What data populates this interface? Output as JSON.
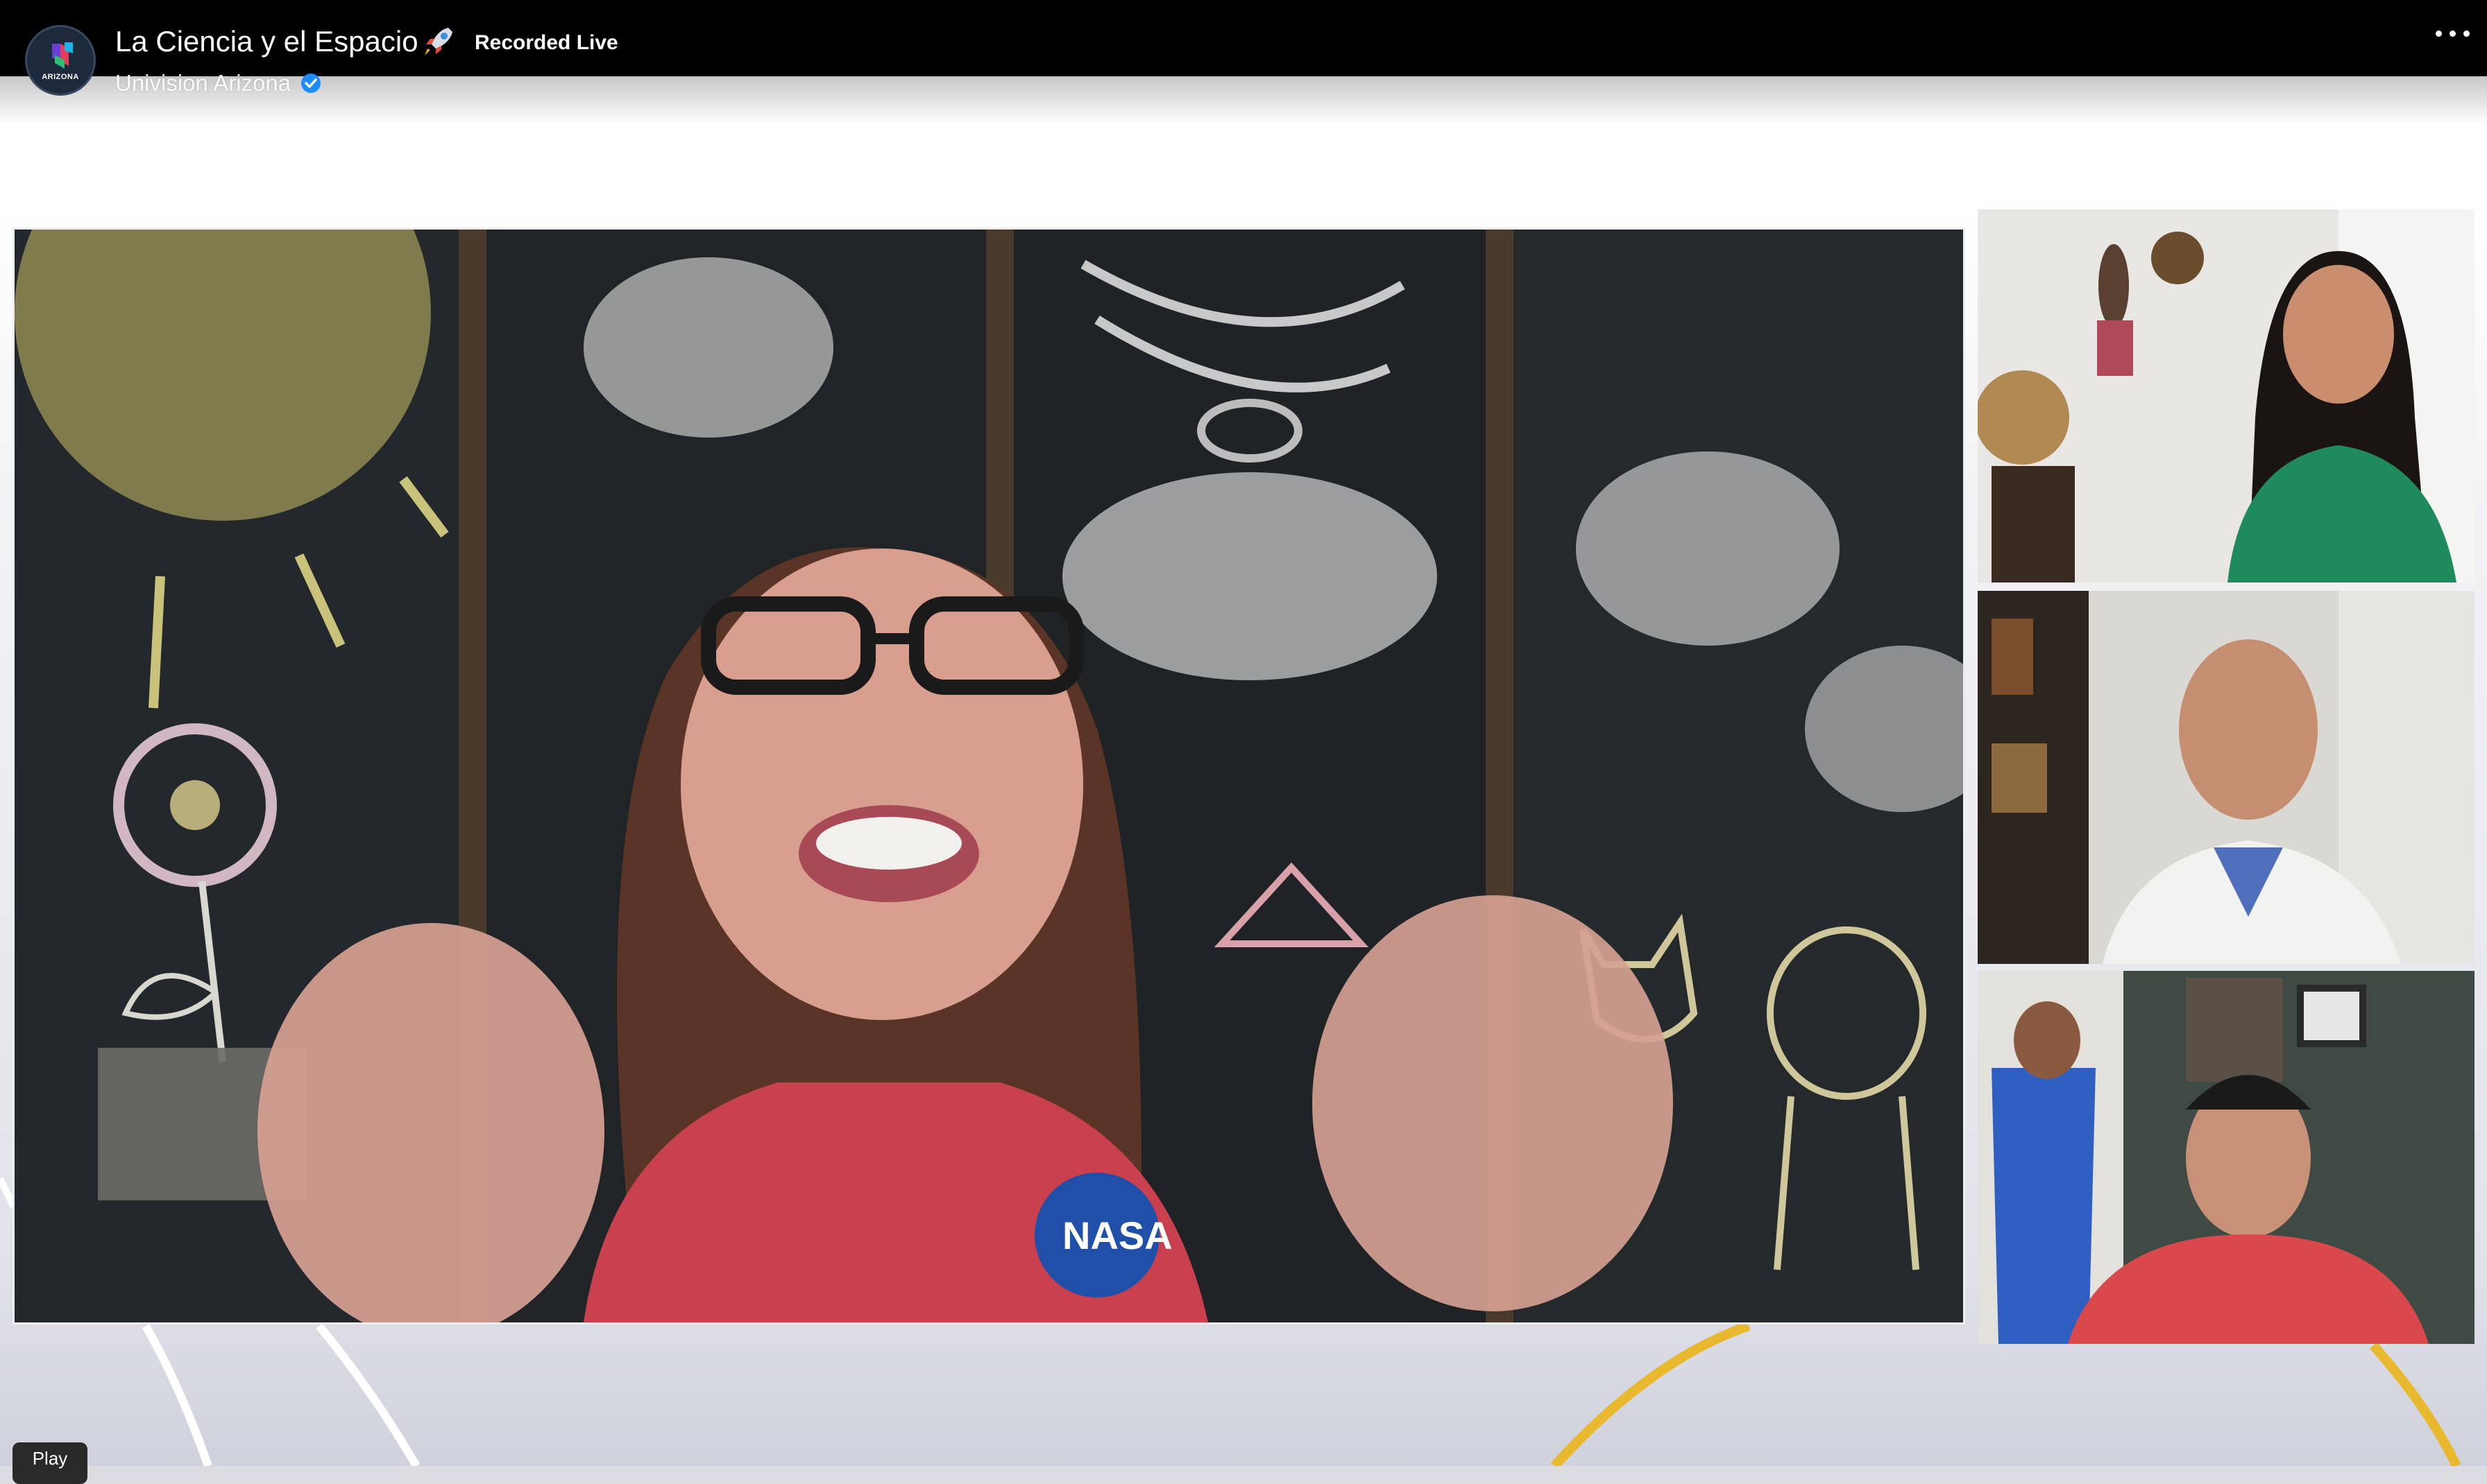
{
  "header": {
    "title": "La Ciencia y el Espacio",
    "title_emoji_icon": "rocket-icon",
    "status": "Recorded Live",
    "channel": "Univision Arizona",
    "avatar_text": "ARIZONA",
    "verified_icon": "verified-badge-icon",
    "menu_icon": "more-options-icon"
  },
  "player": {
    "play_label": "Play"
  },
  "colors": {
    "bar": "#000000",
    "verified": "#1d8cf8",
    "arc_yellow": "#e8b92f",
    "shirt_red": "#c9404e"
  }
}
